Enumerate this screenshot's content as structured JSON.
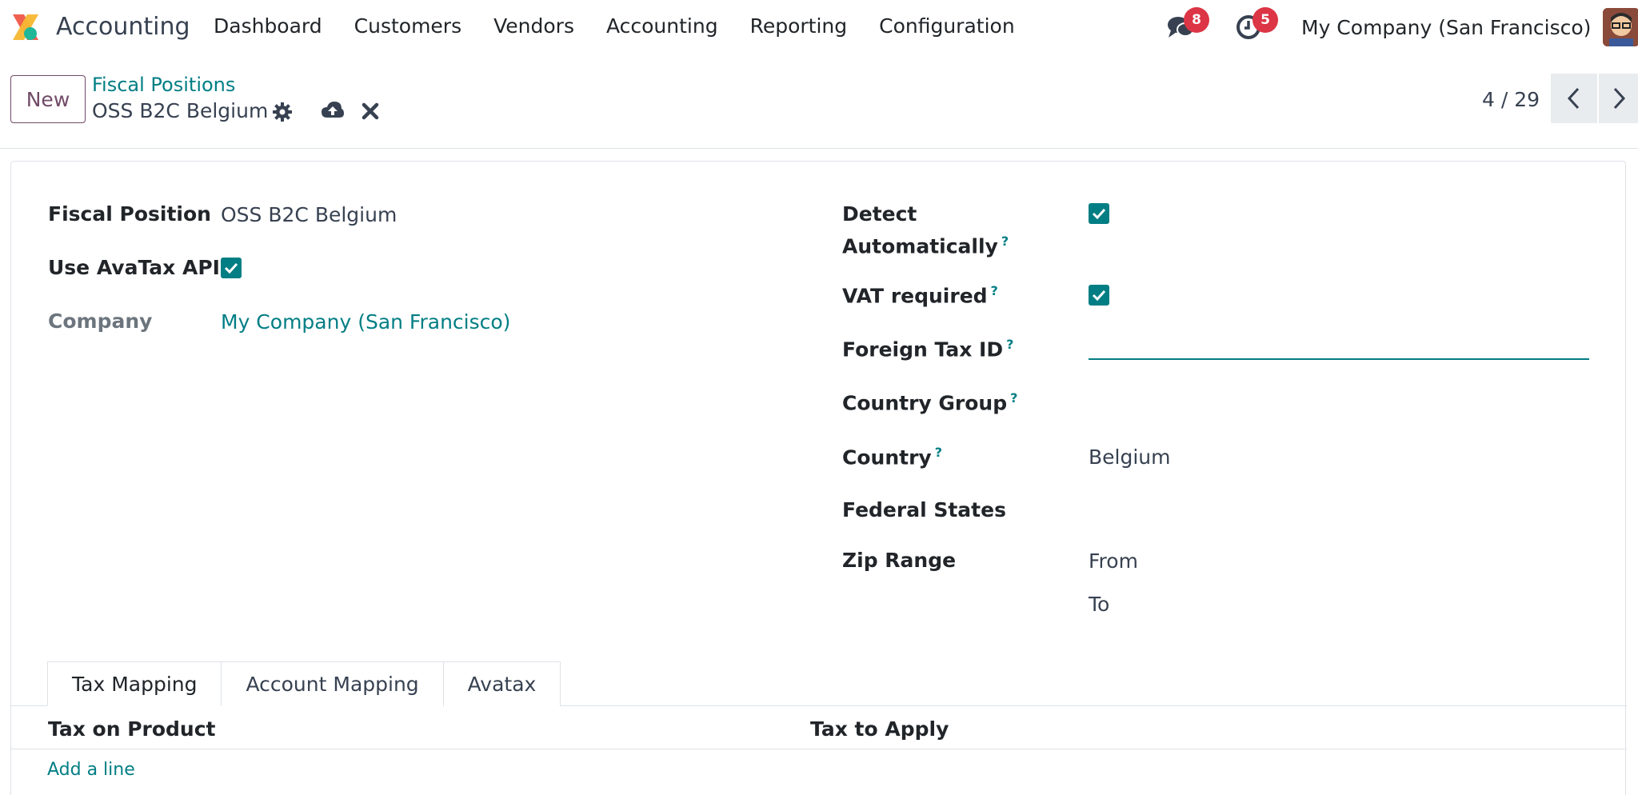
{
  "navbar": {
    "app_name": "Accounting",
    "menu": [
      "Dashboard",
      "Customers",
      "Vendors",
      "Accounting",
      "Reporting",
      "Configuration"
    ],
    "messages_count": "8",
    "activities_count": "5",
    "company": "My Company (San Francisco)"
  },
  "control_panel": {
    "new_label": "New",
    "breadcrumb_parent": "Fiscal Positions",
    "breadcrumb_current": "OSS B2C Belgium",
    "pager": "4 / 29"
  },
  "form": {
    "left": {
      "fiscal_position_label": "Fiscal Position",
      "fiscal_position_value": "OSS B2C Belgium",
      "use_avatax_label": "Use AvaTax API",
      "use_avatax_checked": true,
      "company_label": "Company",
      "company_value": "My Company (San Francisco)"
    },
    "right": {
      "detect_label_line1": "Detect",
      "detect_label_line2": "Automatically",
      "detect_checked": true,
      "vat_required_label": "VAT required",
      "vat_required_checked": true,
      "foreign_tax_id_label": "Foreign Tax ID",
      "foreign_tax_id_value": "",
      "country_group_label": "Country Group",
      "country_label": "Country",
      "country_value": "Belgium",
      "federal_states_label": "Federal States",
      "zip_range_label": "Zip Range",
      "zip_from_label": "From",
      "zip_to_label": "To"
    },
    "help_mark": "?"
  },
  "tabs": [
    "Tax Mapping",
    "Account Mapping",
    "Avatax"
  ],
  "tax_table": {
    "col_tax_on_product": "Tax on Product",
    "col_tax_to_apply": "Tax to Apply",
    "add_line": "Add a line"
  },
  "colors": {
    "primary_teal": "#017e84",
    "brand_purple": "#714b67",
    "badge_red": "#dc3545"
  }
}
